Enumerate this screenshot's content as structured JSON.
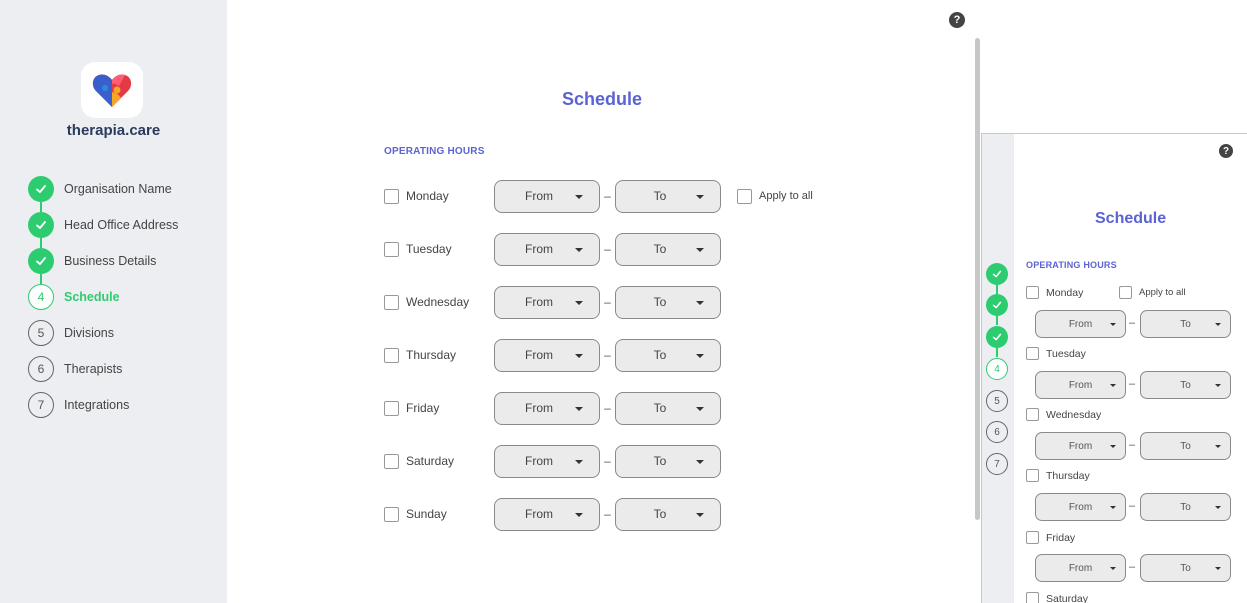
{
  "brand": {
    "name": "therapia.care"
  },
  "steps": [
    {
      "label": "Organisation Name",
      "number": "1",
      "state": "done"
    },
    {
      "label": "Head Office Address",
      "number": "2",
      "state": "done"
    },
    {
      "label": "Business Details",
      "number": "3",
      "state": "done"
    },
    {
      "label": "Schedule",
      "number": "4",
      "state": "current"
    },
    {
      "label": "Divisions",
      "number": "5",
      "state": "todo"
    },
    {
      "label": "Therapists",
      "number": "6",
      "state": "todo"
    },
    {
      "label": "Integrations",
      "number": "7",
      "state": "todo"
    }
  ],
  "help": {
    "glyph": "?"
  },
  "main": {
    "title": "Schedule",
    "section": "OPERATING HOURS",
    "from_label": "From",
    "to_label": "To",
    "dash": "–",
    "apply_all": "Apply to all",
    "days": [
      "Monday",
      "Tuesday",
      "Wednesday",
      "Thursday",
      "Friday",
      "Saturday",
      "Sunday"
    ]
  },
  "preview": {
    "title": "Schedule",
    "section": "OPERATING HOURS",
    "apply_all": "Apply to all",
    "from_label": "From",
    "to_label": "To",
    "dash": "–",
    "days": [
      "Monday",
      "Tuesday",
      "Wednesday",
      "Thursday",
      "Friday",
      "Saturday"
    ],
    "step_numbers": [
      "4",
      "5",
      "6",
      "7"
    ]
  },
  "colors": {
    "accent": "#5b63d3",
    "success": "#2ecc71",
    "sidebar": "#eceef1"
  },
  "icons": {
    "check": "checkmark-icon",
    "caret": "chevron-down-icon",
    "help": "help-icon"
  }
}
